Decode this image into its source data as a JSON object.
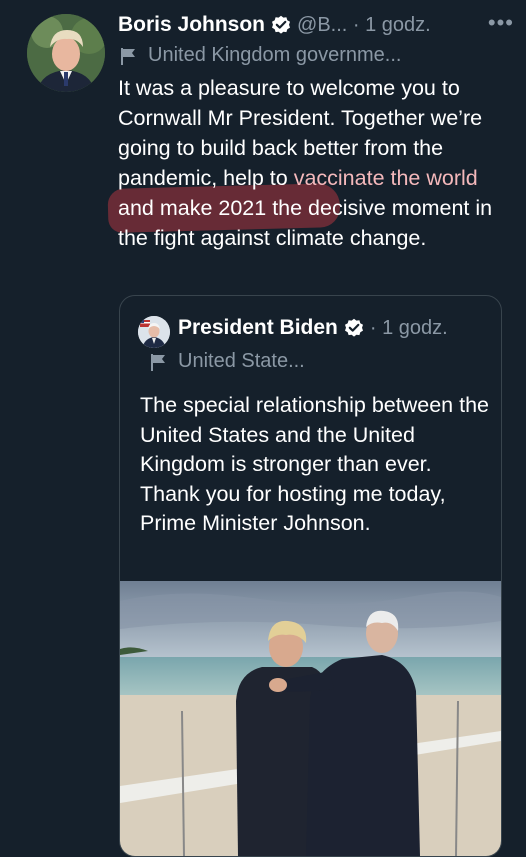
{
  "tweet": {
    "name": "Boris Johnson",
    "handle_time": "@B... · 1 godz.",
    "more": "•••",
    "label": "United Kingdom governme...",
    "text_before": "It was a pleasure to welcome you to Cornwall Mr President. Together we’re going to build back better from the pandemic, help to ",
    "text_highlight": "vaccinate the world",
    "text_after": " and make 2021 the decisive moment in the fight against climate change."
  },
  "quote": {
    "name": "President Biden",
    "time": "· 1 godz.",
    "label": "United State...",
    "text": "The special relationship between the United States and the United Kingdom is stronger than ever. Thank you for hosting me today, Prime Minister Johnson."
  },
  "colors": {
    "background": "#15202b",
    "muted": "#8b98a5",
    "verified": "#ffffff",
    "highlight": "#d83c46"
  }
}
